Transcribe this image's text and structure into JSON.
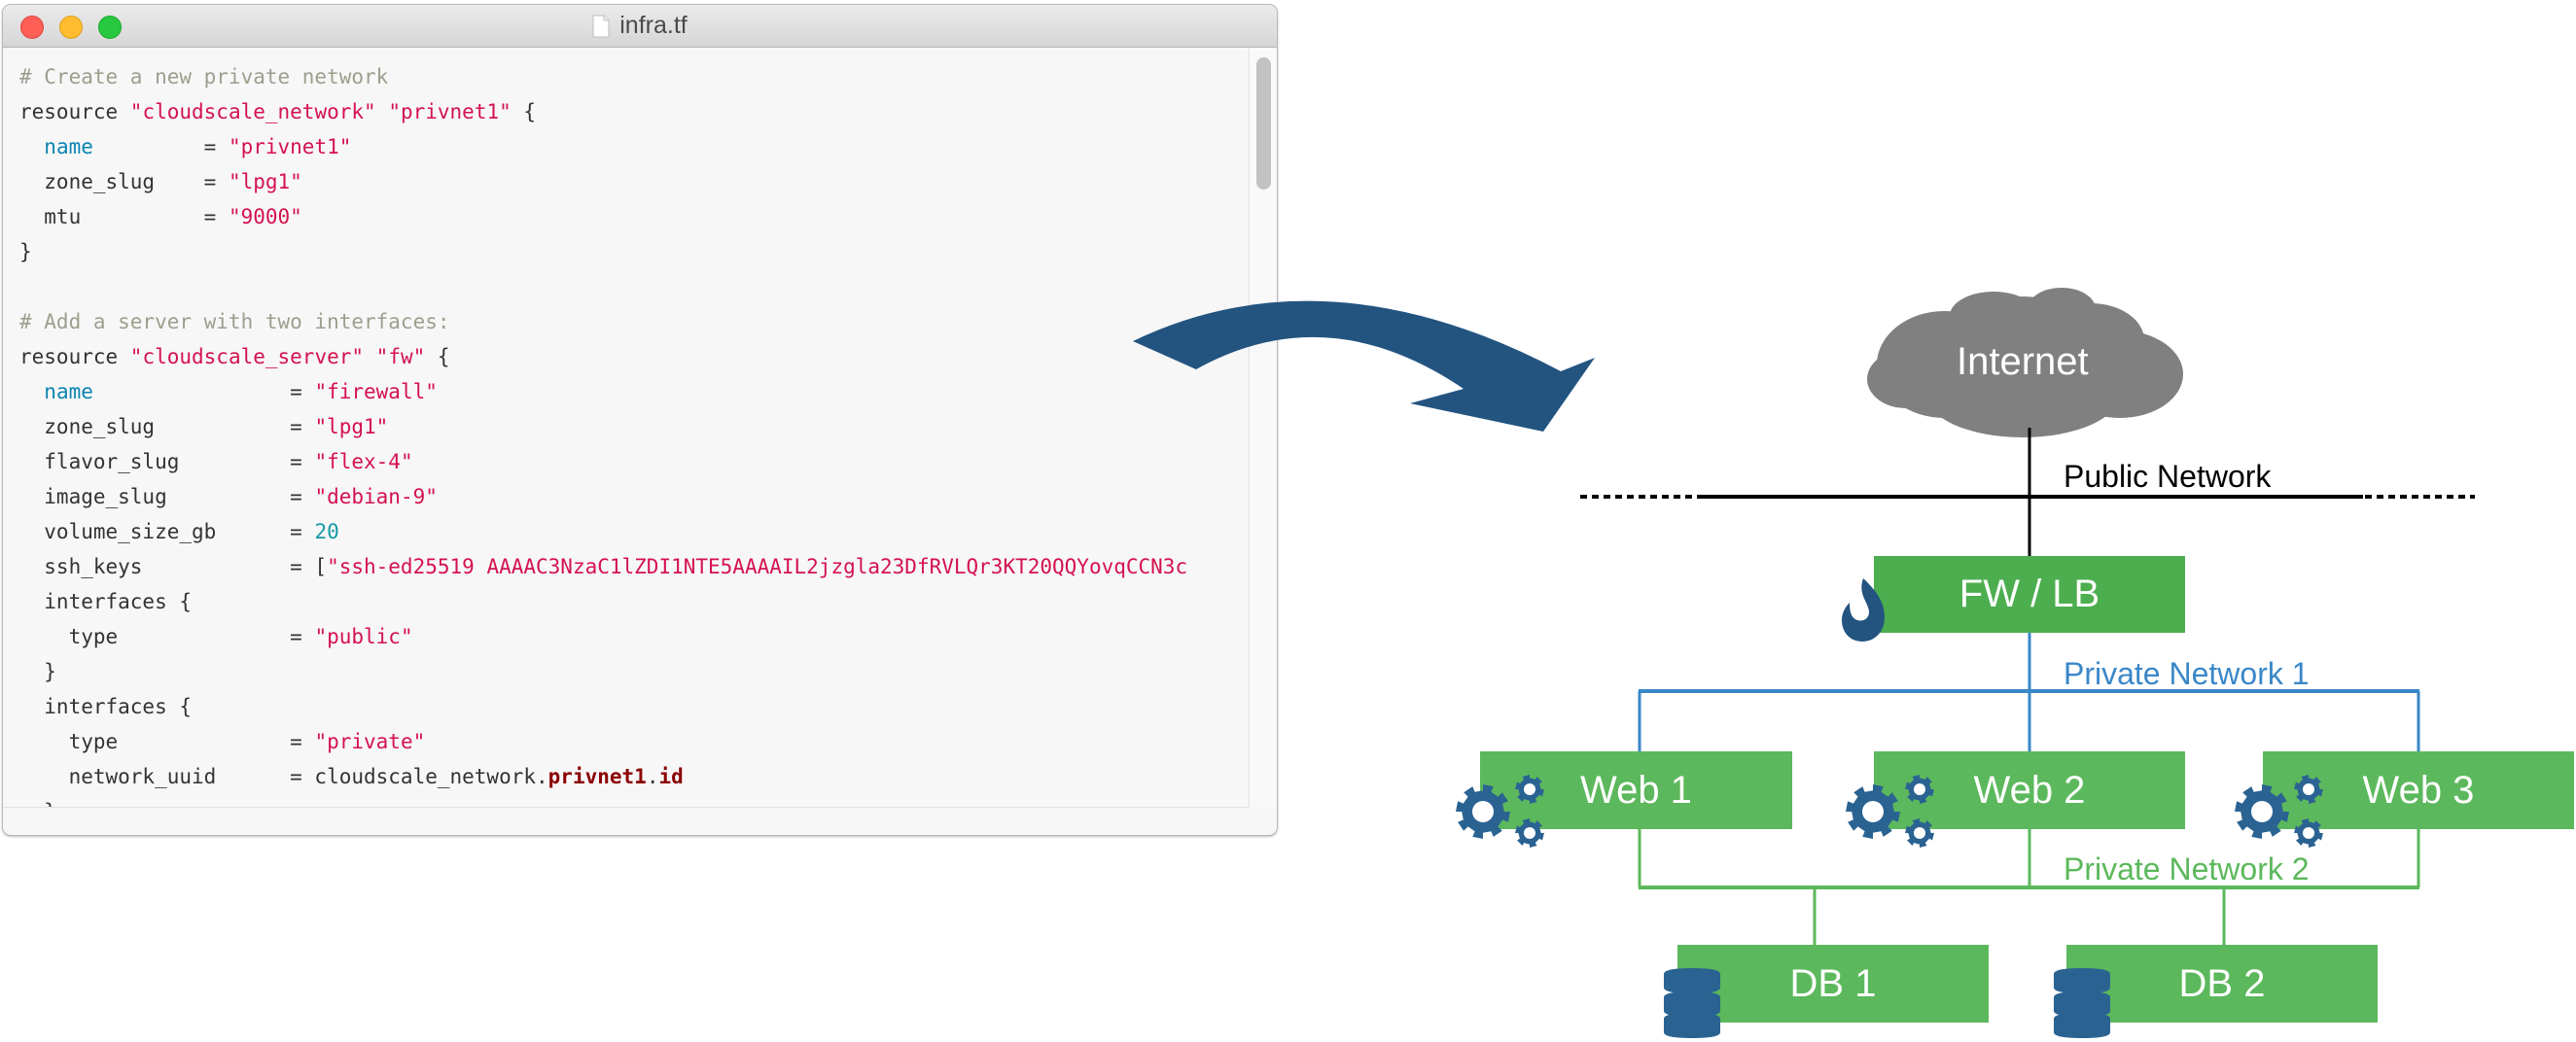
{
  "window": {
    "title": "infra.tf",
    "file_icon": "document-icon"
  },
  "code": {
    "lines": [
      [
        {
          "t": "# Create a new private network",
          "c": "com"
        }
      ],
      [
        {
          "t": "resource "
        },
        {
          "t": "\"cloudscale_network\"",
          "c": "str"
        },
        {
          "t": " "
        },
        {
          "t": "\"privnet1\"",
          "c": "str"
        },
        {
          "t": " {"
        }
      ],
      [
        {
          "t": "  "
        },
        {
          "t": "name",
          "c": "key"
        },
        {
          "t": "         = "
        },
        {
          "t": "\"privnet1\"",
          "c": "str"
        }
      ],
      [
        {
          "t": "  zone_slug    = "
        },
        {
          "t": "\"lpg1\"",
          "c": "str"
        }
      ],
      [
        {
          "t": "  mtu          = "
        },
        {
          "t": "\"9000\"",
          "c": "str"
        }
      ],
      [
        {
          "t": "}"
        }
      ],
      [
        {
          "t": ""
        }
      ],
      [
        {
          "t": "# Add a server with two interfaces:",
          "c": "com"
        }
      ],
      [
        {
          "t": "resource "
        },
        {
          "t": "\"cloudscale_server\"",
          "c": "str"
        },
        {
          "t": " "
        },
        {
          "t": "\"fw\"",
          "c": "str"
        },
        {
          "t": " {"
        }
      ],
      [
        {
          "t": "  "
        },
        {
          "t": "name",
          "c": "key"
        },
        {
          "t": "                = "
        },
        {
          "t": "\"firewall\"",
          "c": "str"
        }
      ],
      [
        {
          "t": "  zone_slug           = "
        },
        {
          "t": "\"lpg1\"",
          "c": "str"
        }
      ],
      [
        {
          "t": "  flavor_slug         = "
        },
        {
          "t": "\"flex-4\"",
          "c": "str"
        }
      ],
      [
        {
          "t": "  image_slug          = "
        },
        {
          "t": "\"debian-9\"",
          "c": "str"
        }
      ],
      [
        {
          "t": "  volume_size_gb      = "
        },
        {
          "t": "20",
          "c": "num"
        }
      ],
      [
        {
          "t": "  ssh_keys            = ["
        },
        {
          "t": "\"ssh-ed25519 AAAAC3NzaC1lZDI1NTE5AAAAIL2jzgla23DfRVLQr3KT20QQYovqCCN3c",
          "c": "str"
        }
      ],
      [
        {
          "t": "  interfaces {"
        }
      ],
      [
        {
          "t": "    type              = "
        },
        {
          "t": "\"public\"",
          "c": "str"
        }
      ],
      [
        {
          "t": "  }"
        }
      ],
      [
        {
          "t": "  interfaces {"
        }
      ],
      [
        {
          "t": "    type              = "
        },
        {
          "t": "\"private\"",
          "c": "str"
        }
      ],
      [
        {
          "t": "    network_uuid      = cloudscale_network."
        },
        {
          "t": "privnet1",
          "c": "ref"
        },
        {
          "t": "."
        },
        {
          "t": "id",
          "c": "ref"
        }
      ],
      [
        {
          "t": "  }"
        }
      ]
    ]
  },
  "diagram": {
    "internet_label": "Internet",
    "public_network_label": "Public Network",
    "fw_lb_label": "FW / LB",
    "private_network_1_label": "Private Network 1",
    "private_network_2_label": "Private Network 2",
    "web_servers": [
      "Web 1",
      "Web 2",
      "Web 3"
    ],
    "databases": [
      "DB 1",
      "DB 2"
    ],
    "colors": {
      "arrow": "#235480",
      "box_green": "#5cb85c",
      "fw_green": "#4cae4f",
      "icon_blue": "#2a6392",
      "private_net_1": "#3a87c8",
      "private_net_2": "#5cb85c",
      "cloud": "#808080"
    }
  }
}
